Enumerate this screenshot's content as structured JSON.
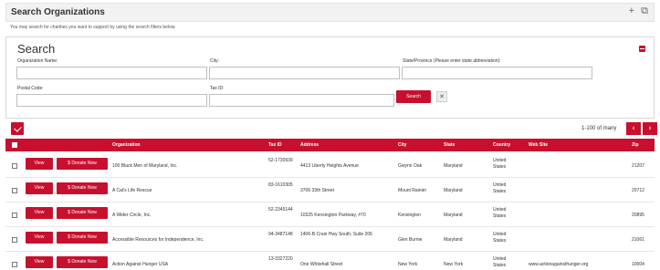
{
  "header": {
    "title": "Search Organizations",
    "icons": [
      "plus-icon",
      "popout-icon"
    ],
    "plus_glyph": "+",
    "popout_glyph": "⧉"
  },
  "intro_text": "You may search for charities you want to support by using the search filters below.",
  "search": {
    "heading": "Search",
    "org_name_label": "Organization Name:",
    "org_name_value": "",
    "city_label": "City:",
    "city_value": "",
    "state_label": "State/Province (Please enter state abbreviation):",
    "state_value": "",
    "postal_label": "Postal Code:",
    "postal_value": "",
    "taxid_label": "Tax ID:",
    "taxid_value": "",
    "search_button": "Search",
    "clear_button": "✕"
  },
  "pager": {
    "info": "1-100 of many",
    "prev": "‹",
    "next": "›"
  },
  "colors": {
    "accent": "#c8102e"
  },
  "table": {
    "columns": [
      "Organization",
      "Tax ID",
      "Address",
      "City",
      "State",
      "Country",
      "Web Site",
      "Zip"
    ],
    "view_label": "View",
    "donate_label": "$ Donate Now",
    "rows": [
      {
        "organization": "100 Black Men of Maryland, Inc.",
        "tax_id": "52-1730939",
        "address": "4413 Liberty Heights Avenue",
        "city": "Gwynn Oak",
        "state": "Maryland",
        "country": "United States",
        "website": "",
        "zip": "21207"
      },
      {
        "organization": "A Cat's Life Rescue",
        "tax_id": "83-1610305",
        "address": "3706 33th Street",
        "city": "Mount Rainier",
        "state": "Maryland",
        "country": "United States",
        "website": "",
        "zip": "20712"
      },
      {
        "organization": "A Wider Circle, Inc.",
        "tax_id": "52-2345144",
        "address": "10325 Kensington Parkway, #70",
        "city": "Kensington",
        "state": "Maryland",
        "country": "United States",
        "website": "",
        "zip": "20895"
      },
      {
        "organization": "Accessible Resources for Independence, Inc.",
        "tax_id": "94-3487148",
        "address": "1406-B Crain Hwy South, Suite 206",
        "city": "Glen Burnie",
        "state": "Maryland",
        "country": "United States",
        "website": "",
        "zip": "21061"
      },
      {
        "organization": "Action Against Hunger USA",
        "tax_id": "13-3327220",
        "address": "One Whitehall Street",
        "city": "New York",
        "state": "New York",
        "country": "United States",
        "website": "www.actionagainsthunger.org",
        "zip": "10004"
      }
    ]
  }
}
